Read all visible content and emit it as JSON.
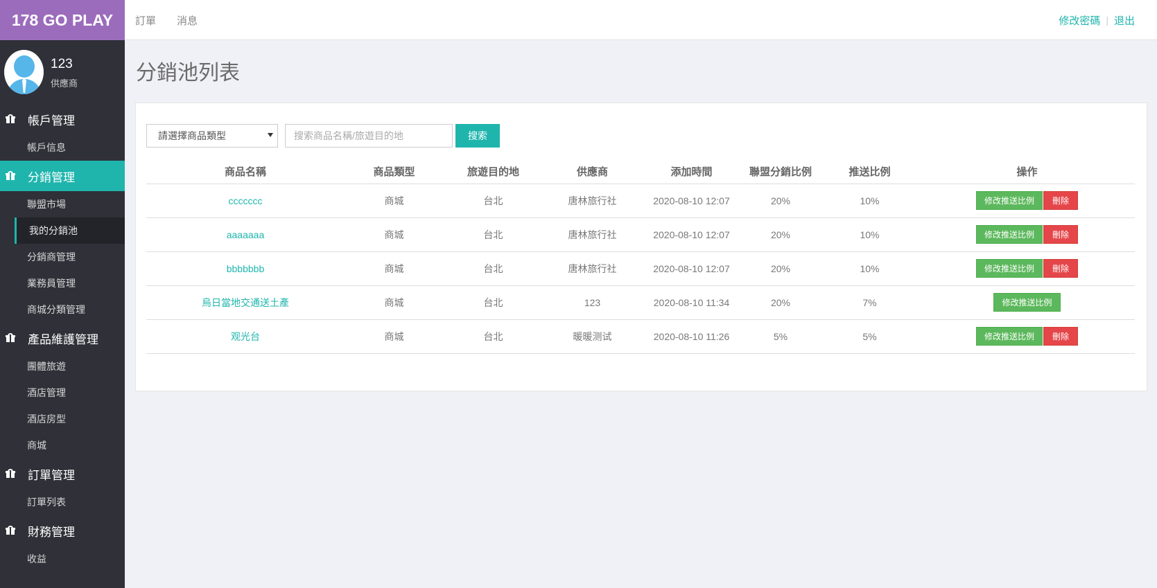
{
  "app": {
    "logo": "178 GO PLAY"
  },
  "user": {
    "name": "123",
    "role": "供應商"
  },
  "sidebar": {
    "groups": [
      {
        "label": "帳戶管理",
        "items": [
          {
            "label": "帳戶信息"
          }
        ]
      },
      {
        "label": "分銷管理",
        "items": [
          {
            "label": "聯盟市場"
          },
          {
            "label": "我的分銷池"
          },
          {
            "label": "分銷商管理"
          },
          {
            "label": "業務員管理"
          },
          {
            "label": "商城分類管理"
          }
        ]
      },
      {
        "label": "產品維護管理",
        "items": [
          {
            "label": "團體旅遊"
          },
          {
            "label": "酒店管理"
          },
          {
            "label": "酒店房型"
          },
          {
            "label": "商城"
          }
        ]
      },
      {
        "label": "訂單管理",
        "items": [
          {
            "label": "訂單列表"
          }
        ]
      },
      {
        "label": "財務管理",
        "items": [
          {
            "label": "收益"
          }
        ]
      }
    ]
  },
  "topnav": {
    "orders": "訂單",
    "messages": "消息",
    "change_password": "修改密碼",
    "separator": "|",
    "logout": "退出"
  },
  "page": {
    "title": "分銷池列表"
  },
  "filter": {
    "select_value": "請選擇商品類型",
    "search_placeholder": "搜索商品名稱/旅遊目的地",
    "search_button": "搜索"
  },
  "table": {
    "headers": [
      "商品名稱",
      "商品類型",
      "旅遊目的地",
      "供應商",
      "添加時間",
      "聯盟分銷比例",
      "推送比例",
      "操作"
    ],
    "edit_label": "修改推送比例",
    "delete_label": "刪除",
    "rows": [
      {
        "name": "ccccccc",
        "type": "商城",
        "dest": "台北",
        "supplier": "唐林旅行社",
        "time": "2020-08-10 12:07",
        "alliance": "20%",
        "push": "10%"
      },
      {
        "name": "aaaaaaa",
        "type": "商城",
        "dest": "台北",
        "supplier": "唐林旅行社",
        "time": "2020-08-10 12:07",
        "alliance": "20%",
        "push": "10%"
      },
      {
        "name": "bbbbbbb",
        "type": "商城",
        "dest": "台北",
        "supplier": "唐林旅行社",
        "time": "2020-08-10 12:07",
        "alliance": "20%",
        "push": "10%"
      },
      {
        "name": "烏日當地交通送土產",
        "type": "商城",
        "dest": "台北",
        "supplier": "123",
        "time": "2020-08-10 11:34",
        "alliance": "20%",
        "push": "7%"
      },
      {
        "name": "观光台",
        "type": "商城",
        "dest": "台北",
        "supplier": "暖暖测试",
        "time": "2020-08-10 11:26",
        "alliance": "5%",
        "push": "5%"
      }
    ]
  },
  "colors": {
    "accent": "#1fb5ad",
    "logo_bg": "#9b6cbc",
    "sidebar_bg": "#2f3038",
    "edit_btn": "#5cb85c",
    "delete_btn": "#e5464a"
  }
}
